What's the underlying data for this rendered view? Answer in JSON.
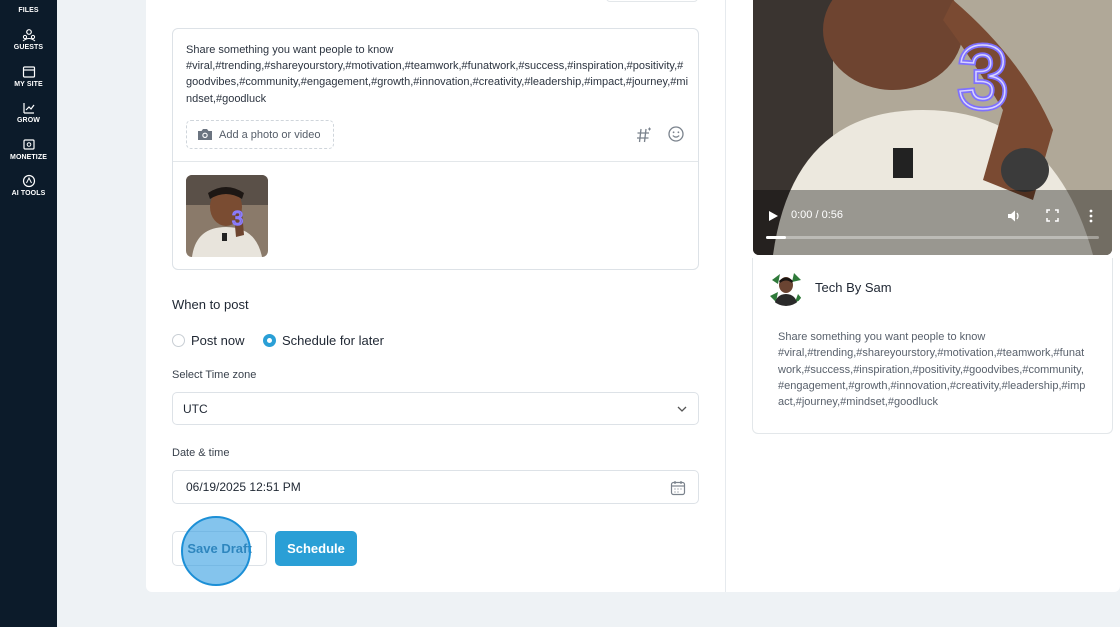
{
  "sidebar": {
    "items": [
      {
        "label": "FILES",
        "icon": "folder-icon"
      },
      {
        "label": "GUESTS",
        "icon": "users-icon"
      },
      {
        "label": "MY SITE",
        "icon": "browser-icon"
      },
      {
        "label": "GROW",
        "icon": "chart-icon"
      },
      {
        "label": "MONETIZE",
        "icon": "cash-icon"
      },
      {
        "label": "AI TOOLS",
        "icon": "ai-icon"
      }
    ]
  },
  "composer": {
    "text": "Share something you want people to know\n#viral,#trending,#shareyourstory,#motivation,#teamwork,#funatwork,#success,#inspiration,#positivity,#goodvibes,#community,#engagement,#growth,#innovation,#creativity,#leadership,#impact,#journey,#mindset,#goodluck",
    "add_media_label": "Add a photo or video"
  },
  "schedule": {
    "title": "When to post",
    "options": [
      "Post now",
      "Schedule for later"
    ],
    "selected": "Schedule for later",
    "timezone_label": "Select Time zone",
    "timezone_value": "UTC",
    "datetime_label": "Date & time",
    "datetime_value": "06/19/2025 12:51 PM"
  },
  "actions": {
    "save_draft": "Save Draft",
    "schedule": "Schedule"
  },
  "preview": {
    "video_time": "0:00 / 0:56",
    "video_progress": 0.06,
    "author": "Tech By Sam",
    "text": "Share something you want people to know\n#viral,#trending,#shareyourstory,#motivation,#teamwork,#funatwork,#success,#inspiration,#positivity,#goodvibes,#community,#engagement,#growth,#innovation,#creativity,#leadership,#impact,#journey,#mindset,#goodluck"
  },
  "colors": {
    "sidebar_bg": "#0c1b2a",
    "accent": "#2a9fd6",
    "page_bg": "#eef2f5"
  }
}
